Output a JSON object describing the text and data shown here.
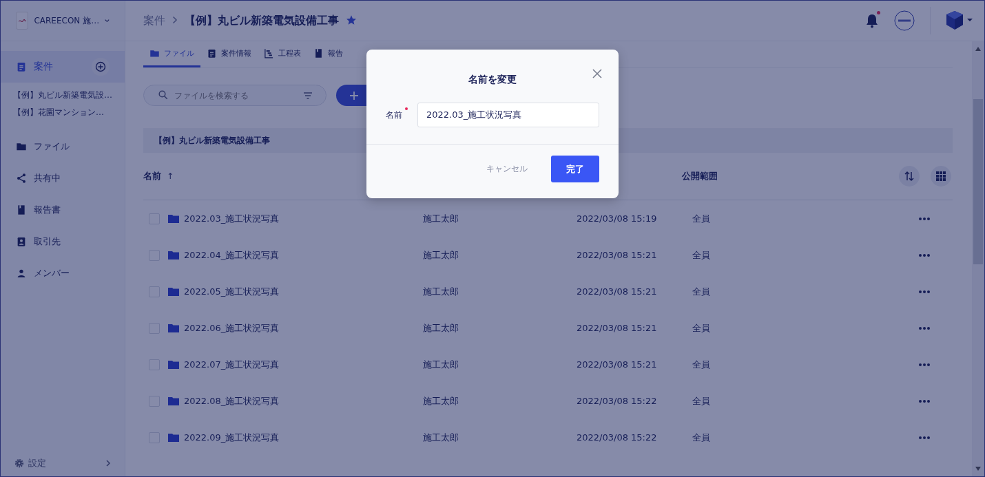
{
  "sidebar": {
    "company": "CAREECON 施…",
    "nav": [
      {
        "label": "案件",
        "kind": "projects",
        "selected": true,
        "children": [
          {
            "label": "【例】丸ビル新築電気設…"
          },
          {
            "label": "【例】花園マンション…"
          }
        ]
      },
      {
        "label": "ファイル",
        "kind": "folder",
        "selected": false
      },
      {
        "label": "共有中",
        "kind": "share",
        "selected": false
      },
      {
        "label": "報告書",
        "kind": "book",
        "selected": false
      },
      {
        "label": "取引先",
        "kind": "contact",
        "selected": false
      },
      {
        "label": "メンバー",
        "kind": "person",
        "selected": false
      }
    ],
    "settings": "設定"
  },
  "header": {
    "breadcrumb": "案件",
    "title": "【例】丸ビル新築電気設備工事",
    "starred": true,
    "unread": true
  },
  "tabs": [
    {
      "label": "ファイル",
      "kind": "folder",
      "selected": true
    },
    {
      "label": "案件情報",
      "kind": "clipboard",
      "selected": false
    },
    {
      "label": "工程表",
      "kind": "gantt",
      "selected": false
    },
    {
      "label": "報告",
      "kind": "book",
      "selected": false
    }
  ],
  "search": {
    "placeholder": "ファイルを検索する"
  },
  "folder_path": "【例】丸ビル新築電気設備工事",
  "columns": [
    {
      "label": "名前",
      "sort_arrow": "↑"
    },
    {
      "label": "公開範囲"
    }
  ],
  "rows": [
    {
      "name": "2022.03_施工状況写真",
      "owner": "施工太郎",
      "date": "2022/03/08 15:19",
      "scope": "全員",
      "checked": false
    },
    {
      "name": "2022.04_施工状況写真",
      "owner": "施工太郎",
      "date": "2022/03/08 15:21",
      "scope": "全員",
      "checked": false
    },
    {
      "name": "2022.05_施工状況写真",
      "owner": "施工太郎",
      "date": "2022/03/08 15:21",
      "scope": "全員",
      "checked": false
    },
    {
      "name": "2022.06_施工状況写真",
      "owner": "施工太郎",
      "date": "2022/03/08 15:21",
      "scope": "全員",
      "checked": false
    },
    {
      "name": "2022.07_施工状況写真",
      "owner": "施工太郎",
      "date": "2022/03/08 15:21",
      "scope": "全員",
      "checked": false
    },
    {
      "name": "2022.08_施工状況写真",
      "owner": "施工太郎",
      "date": "2022/03/08 15:22",
      "scope": "全員",
      "checked": false
    },
    {
      "name": "2022.09_施工状況写真",
      "owner": "施工太郎",
      "date": "2022/03/08 15:22",
      "scope": "全員",
      "checked": false
    }
  ],
  "dialog": {
    "title": "名前を変更",
    "field_label": "名前",
    "required": true,
    "value": "2022.03_施工状況写真",
    "cancel": "キャンセル",
    "confirm": "完了"
  }
}
